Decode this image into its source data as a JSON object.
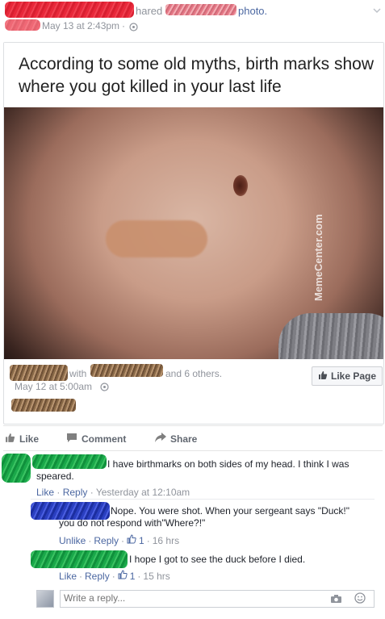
{
  "header": {
    "shared_text": "hared",
    "photo_text": "photo.",
    "timestamp": "May 13 at 2:43pm",
    "dot": "·"
  },
  "meme": {
    "caption": "According to some old myths, birth marks show where you got killed in your last life",
    "watermark": "MemeCenter.com"
  },
  "shared_post": {
    "with_text": "with",
    "others_text": "and 6 others.",
    "timestamp": "May 12 at 5:00am",
    "like_page_label": "Like Page"
  },
  "actions": {
    "like": "Like",
    "comment": "Comment",
    "share": "Share"
  },
  "comments": [
    {
      "text": "I have birthmarks on both sides of my head. I think I was speared.",
      "like": "Like",
      "reply": "Reply",
      "time": "Yesterday at 12:10am"
    }
  ],
  "replies": [
    {
      "text": "Nope. You were shot. When your sergeant says \"Duck!\" you do not respond with\"Where?!\"",
      "like": "Unlike",
      "reply": "Reply",
      "likes_count": "1",
      "time": "16 hrs"
    },
    {
      "text": "I hope I got to see the duck before I died.",
      "like": "Like",
      "reply": "Reply",
      "likes_count": "1",
      "time": "15 hrs"
    }
  ],
  "reply_box": {
    "placeholder": "Write a reply..."
  },
  "colors": {
    "link_blue": "#4b67a1",
    "meta_grey": "#90949c"
  }
}
